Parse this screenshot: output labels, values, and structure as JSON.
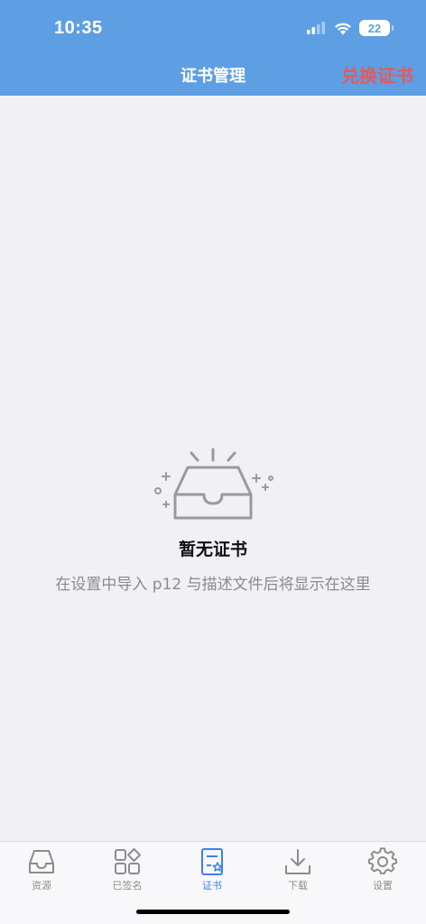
{
  "status": {
    "time": "10:35",
    "battery": "22"
  },
  "nav": {
    "title": "证书管理",
    "action": "兑换证书"
  },
  "empty": {
    "title": "暂无证书",
    "description": "在设置中导入 p12 与描述文件后将显示在这里"
  },
  "tabs": [
    {
      "label": "资源",
      "icon": "inbox-icon"
    },
    {
      "label": "已签名",
      "icon": "apps-grid-icon"
    },
    {
      "label": "证书",
      "icon": "certificate-icon",
      "active": true
    },
    {
      "label": "下载",
      "icon": "download-icon"
    },
    {
      "label": "设置",
      "icon": "gear-icon"
    }
  ],
  "colors": {
    "header": "#5e9ee3",
    "action": "#e55a5a",
    "active_tab": "#3b82e6",
    "background": "#f1f0f5"
  }
}
